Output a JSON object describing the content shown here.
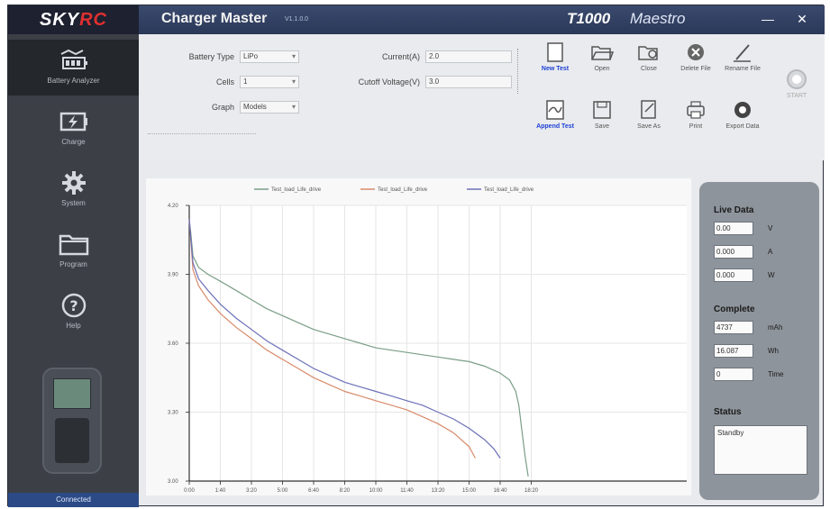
{
  "title_bar": {
    "brand_part1": "SKY",
    "brand_part2": "RC",
    "app_title": "Charger Master",
    "version": "V1.1.0.0",
    "model_name": "T1000",
    "model_suffix": "Maestro",
    "minimize": "—",
    "close": "✕"
  },
  "sidebar": {
    "items": [
      {
        "label": "Battery Analyzer",
        "icon": "battery-analyzer-icon"
      },
      {
        "label": "Charge",
        "icon": "charge-icon"
      },
      {
        "label": "System",
        "icon": "gear-icon"
      },
      {
        "label": "Program",
        "icon": "folder-icon"
      },
      {
        "label": "Help",
        "icon": "help-icon"
      }
    ],
    "status": "Connected"
  },
  "form": {
    "battery_type_label": "Battery Type",
    "battery_type_value": "LiPo",
    "cells_label": "Cells",
    "cells_value": "1",
    "graph_label": "Graph",
    "graph_value": "Models",
    "current_label": "Current(A)",
    "current_value": "2.0",
    "cutoff_label": "Cutoff Voltage(V)",
    "cutoff_value": "3.0"
  },
  "toolbar": {
    "buttons": [
      {
        "label": "New Test",
        "icon": "new-file-icon",
        "highlight": true
      },
      {
        "label": "Open",
        "icon": "open-folder-icon",
        "highlight": false
      },
      {
        "label": "Close",
        "icon": "close-file-icon",
        "highlight": false
      },
      {
        "label": "Delete File",
        "icon": "delete-icon",
        "highlight": false
      },
      {
        "label": "Rename File",
        "icon": "rename-icon",
        "highlight": false
      },
      {
        "label": "Append Test",
        "icon": "append-test-icon",
        "highlight": true
      },
      {
        "label": "Save",
        "icon": "save-icon",
        "highlight": false
      },
      {
        "label": "Save As",
        "icon": "save-as-icon",
        "highlight": false
      },
      {
        "label": "Print",
        "icon": "print-icon",
        "highlight": false
      },
      {
        "label": "Export Data",
        "icon": "export-icon",
        "highlight": false
      }
    ],
    "start_label": "START"
  },
  "chart_data": {
    "type": "line",
    "title": "",
    "xlabel": "",
    "ylabel": "",
    "legend_position": "top-center",
    "grid": true,
    "xlim": [
      0,
      1600
    ],
    "ylim": [
      3.0,
      4.2
    ],
    "x_ticks": [
      "0:00",
      "1:40",
      "3:20",
      "5:00",
      "6:40",
      "8:20",
      "10:00",
      "11:40",
      "13:20",
      "15:00",
      "16:40",
      "18:20"
    ],
    "x_tick_values": [
      0,
      100,
      200,
      300,
      400,
      500,
      600,
      700,
      800,
      900,
      1000,
      1100
    ],
    "y_ticks": [
      "3.00",
      "3.30",
      "3.60",
      "3.90",
      "4.20"
    ],
    "y_tick_values": [
      3.0,
      3.3,
      3.6,
      3.9,
      4.2
    ],
    "series": [
      {
        "name": "Test_load_Life_drive",
        "color": "#7a9e86",
        "x": [
          0,
          5,
          12,
          30,
          60,
          100,
          150,
          200,
          250,
          300,
          350,
          400,
          450,
          500,
          550,
          600,
          650,
          700,
          750,
          800,
          850,
          900,
          950,
          1000,
          1030,
          1050,
          1060,
          1070,
          1080,
          1090
        ],
        "y": [
          4.14,
          4.08,
          3.98,
          3.93,
          3.9,
          3.87,
          3.83,
          3.79,
          3.75,
          3.72,
          3.69,
          3.66,
          3.64,
          3.62,
          3.6,
          3.58,
          3.57,
          3.56,
          3.55,
          3.54,
          3.53,
          3.52,
          3.5,
          3.47,
          3.44,
          3.39,
          3.33,
          3.22,
          3.11,
          3.02
        ]
      },
      {
        "name": "Test_load_Life_drive",
        "color": "#d98a6a",
        "x": [
          0,
          5,
          12,
          30,
          60,
          100,
          150,
          200,
          250,
          300,
          350,
          400,
          450,
          500,
          550,
          600,
          650,
          700,
          750,
          800,
          850,
          900,
          920
        ],
        "y": [
          4.14,
          4.05,
          3.92,
          3.85,
          3.79,
          3.73,
          3.67,
          3.62,
          3.57,
          3.53,
          3.49,
          3.45,
          3.42,
          3.39,
          3.37,
          3.35,
          3.33,
          3.31,
          3.28,
          3.25,
          3.21,
          3.15,
          3.1
        ]
      },
      {
        "name": "Test_load_Life_drive",
        "color": "#6c70b8",
        "x": [
          0,
          5,
          12,
          30,
          60,
          100,
          150,
          200,
          250,
          300,
          350,
          400,
          450,
          500,
          550,
          600,
          650,
          700,
          750,
          800,
          850,
          900,
          950,
          980,
          1000
        ],
        "y": [
          4.14,
          4.06,
          3.95,
          3.88,
          3.83,
          3.77,
          3.71,
          3.66,
          3.61,
          3.57,
          3.53,
          3.49,
          3.46,
          3.43,
          3.41,
          3.39,
          3.37,
          3.35,
          3.33,
          3.3,
          3.27,
          3.23,
          3.18,
          3.14,
          3.1
        ]
      }
    ]
  },
  "live_data": {
    "title": "Live Data",
    "voltage": "0.00",
    "voltage_unit": "V",
    "current": "0.000",
    "current_unit": "A",
    "power": "0.000",
    "power_unit": "W"
  },
  "complete": {
    "title": "Complete",
    "capacity": "4737",
    "capacity_unit": "mAh",
    "energy": "16.087",
    "energy_unit": "Wh",
    "time": "0",
    "time_unit": "Time"
  },
  "status": {
    "title": "Status",
    "value": "Standby"
  }
}
